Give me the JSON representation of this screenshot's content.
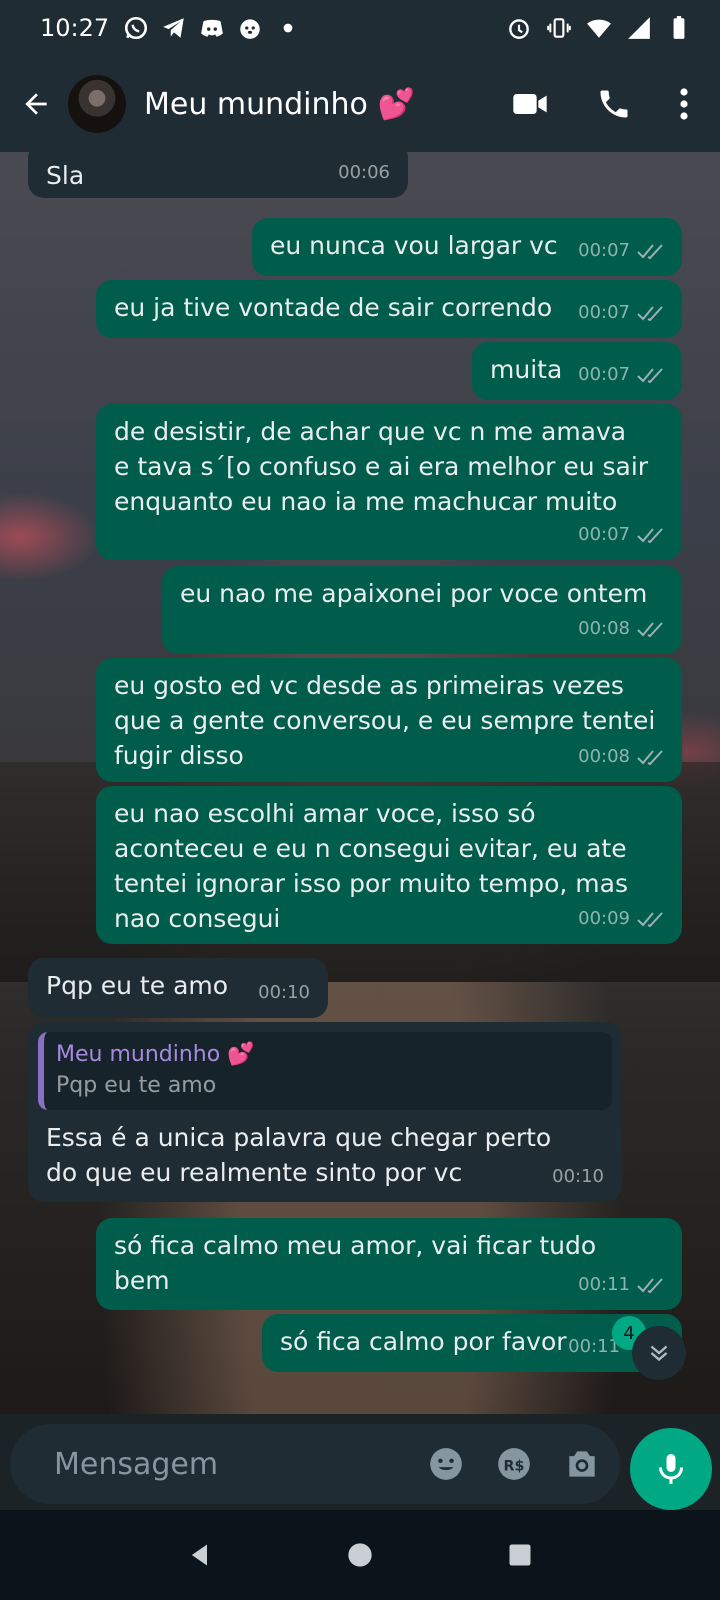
{
  "status_bar": {
    "time": "10:27",
    "left_icons": [
      "whatsapp-icon",
      "telegram-icon",
      "discord-icon",
      "dog-app-icon",
      "dot-icon"
    ],
    "right_icons": [
      "alarm-icon",
      "vibrate-icon",
      "wifi-icon",
      "signal-icon",
      "battery-icon"
    ]
  },
  "header": {
    "contact_name": "Meu mundinho 💕"
  },
  "messages": [
    {
      "dir": "in",
      "text": "Sla",
      "time": "00:06"
    },
    {
      "dir": "out",
      "text": "eu nunca vou largar vc",
      "time": "00:07"
    },
    {
      "dir": "out",
      "text": "eu ja tive vontade de sair correndo",
      "time": "00:07"
    },
    {
      "dir": "out",
      "text": "muita",
      "time": "00:07"
    },
    {
      "dir": "out",
      "text": "de desistir, de achar que vc n me amava\ne tava s´[o confuso e ai era melhor eu sair\nenquanto eu nao ia me machucar muito",
      "time": "00:07"
    },
    {
      "dir": "out",
      "text": "eu nao me apaixonei por voce ontem",
      "time": "00:08"
    },
    {
      "dir": "out",
      "text": "eu gosto ed vc desde as primeiras vezes\nque a gente conversou, e eu sempre tentei\nfugir disso",
      "time": "00:08"
    },
    {
      "dir": "out",
      "text": "eu nao escolhi amar voce, isso só\naconteceu e eu n consegui evitar, eu ate\ntentei ignorar isso por muito tempo, mas\nnao consegui",
      "time": "00:09"
    },
    {
      "dir": "in",
      "text": "Pqp eu te amo",
      "time": "00:10"
    },
    {
      "dir": "in",
      "quote_author": "Meu mundinho 💕",
      "quote_text": "Pqp eu te amo",
      "text": "Essa é a unica palavra que chegar perto\ndo que eu realmente sinto por vc",
      "time": "00:10"
    },
    {
      "dir": "out",
      "text": "só fica calmo meu amor, vai ficar tudo\nbem",
      "time": "00:11"
    },
    {
      "dir": "out",
      "text": "só fica calmo por favor",
      "time": "00:11"
    }
  ],
  "unread_badge": "4",
  "composer": {
    "placeholder": "Mensagem"
  },
  "colors": {
    "outgoing_bubble": "#005c4b",
    "incoming_bubble": "#1f2c33",
    "accent": "#00a884",
    "quote_author": "#a58be0"
  }
}
